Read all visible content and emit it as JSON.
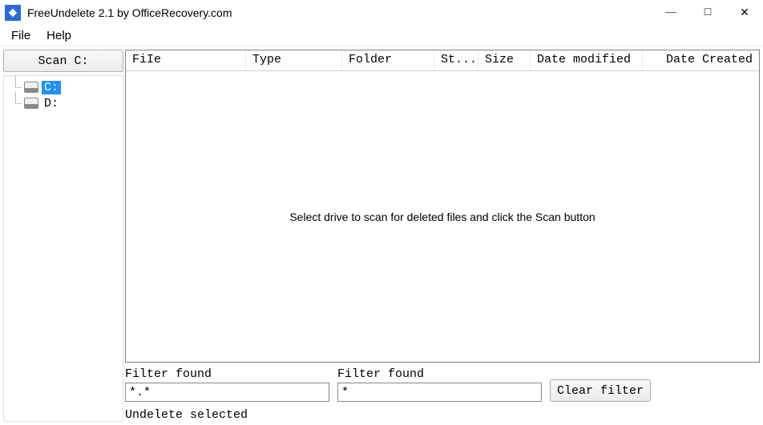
{
  "window": {
    "title": "FreeUndelete 2.1 by OfficeRecovery.com"
  },
  "menus": {
    "file": "File",
    "help": "Help"
  },
  "scan": {
    "button": "Scan C:"
  },
  "drives": [
    {
      "label": "C:",
      "selected": true
    },
    {
      "label": "D:",
      "selected": false
    }
  ],
  "columns": {
    "file": "FiIe",
    "type": "Type",
    "folder": "Folder",
    "state": "St...",
    "size": "Size",
    "modified": "Date modified",
    "created": "Date Created"
  },
  "list": {
    "empty_message": "Select drive to scan for deleted files and click the Scan button"
  },
  "filter": {
    "label1": "Filter found",
    "value1": "*.*",
    "label2": "Filter found",
    "value2": "*",
    "clear": "Clear filter"
  },
  "undelete": {
    "label": "Undelete selected"
  }
}
